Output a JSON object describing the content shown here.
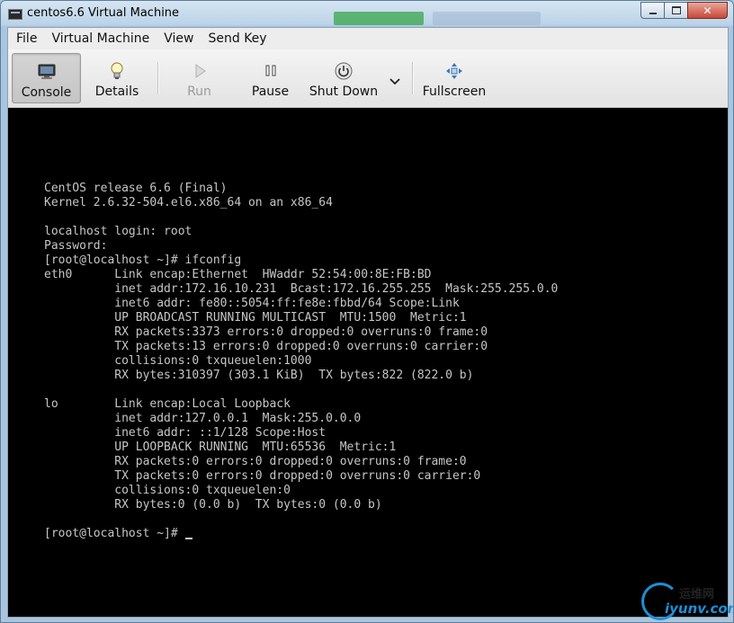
{
  "window": {
    "title": "centos6.6 Virtual Machine",
    "controls": {
      "minimize": "minimize",
      "maximize": "maximize",
      "close": "✕"
    }
  },
  "menubar": {
    "items": [
      "File",
      "Virtual Machine",
      "View",
      "Send Key"
    ]
  },
  "toolbar": {
    "console_label": "Console",
    "details_label": "Details",
    "run_label": "Run",
    "pause_label": "Pause",
    "shutdown_label": "Shut Down",
    "fullscreen_label": "Fullscreen",
    "icons": [
      "monitor-icon",
      "lightbulb-icon",
      "play-icon",
      "pause-icon",
      "power-icon",
      "chevron-down-icon",
      "fullscreen-icon"
    ]
  },
  "console": {
    "lines": [
      "CentOS release 6.6 (Final)",
      "Kernel 2.6.32-504.el6.x86_64 on an x86_64",
      "",
      "localhost login: root",
      "Password:",
      "[root@localhost ~]# ifconfig",
      "eth0      Link encap:Ethernet  HWaddr 52:54:00:8E:FB:BD",
      "          inet addr:172.16.10.231  Bcast:172.16.255.255  Mask:255.255.0.0",
      "          inet6 addr: fe80::5054:ff:fe8e:fbbd/64 Scope:Link",
      "          UP BROADCAST RUNNING MULTICAST  MTU:1500  Metric:1",
      "          RX packets:3373 errors:0 dropped:0 overruns:0 frame:0",
      "          TX packets:13 errors:0 dropped:0 overruns:0 carrier:0",
      "          collisions:0 txqueuelen:1000",
      "          RX bytes:310397 (303.1 KiB)  TX bytes:822 (822.0 b)",
      "",
      "lo        Link encap:Local Loopback",
      "          inet addr:127.0.0.1  Mask:255.0.0.0",
      "          inet6 addr: ::1/128 Scope:Host",
      "          UP LOOPBACK RUNNING  MTU:65536  Metric:1",
      "          RX packets:0 errors:0 dropped:0 overruns:0 frame:0",
      "          TX packets:0 errors:0 dropped:0 overruns:0 carrier:0",
      "          collisions:0 txqueuelen:0",
      "          RX bytes:0 (0.0 b)  TX bytes:0 (0.0 b)",
      ""
    ],
    "prompt": "[root@localhost ~]# "
  },
  "watermark": {
    "cn": "运维网",
    "en": "iyunv.com"
  },
  "colors": {
    "terminal_bg": "#000000",
    "terminal_fg": "#c6c6c6",
    "frame": "#a9c6de",
    "watermark_blue": "#1d8fd6"
  }
}
